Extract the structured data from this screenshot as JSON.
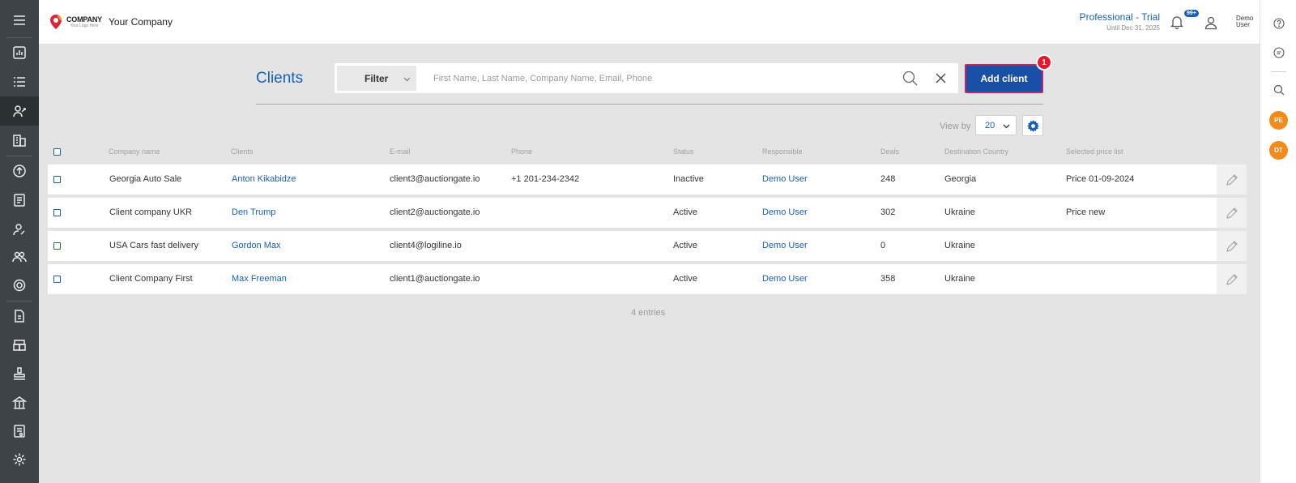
{
  "header": {
    "logo_word": "COMPANY",
    "logo_tagline": "Your Logo Here",
    "company_name": "Your Company",
    "plan_name": "Professional - Trial",
    "plan_until": "Until Dec 31, 2025",
    "notifications_badge": "99+",
    "user_name": "Demo User"
  },
  "sidebar": {
    "items": [
      {
        "icon": "menu-icon"
      },
      {
        "icon": "dashboard-icon"
      },
      {
        "icon": "list-icon"
      },
      {
        "icon": "clients-icon",
        "active": true
      },
      {
        "icon": "buildings-icon"
      },
      {
        "icon": "exchange-icon"
      },
      {
        "icon": "ledger-icon"
      },
      {
        "icon": "user-edit-icon"
      },
      {
        "icon": "team-icon"
      },
      {
        "icon": "settings-gear-icon"
      },
      {
        "icon": "document-icon"
      },
      {
        "icon": "warehouse-icon"
      },
      {
        "icon": "stamp-icon"
      },
      {
        "icon": "port-icon"
      },
      {
        "icon": "invoice-icon"
      },
      {
        "icon": "settings-icon"
      }
    ]
  },
  "rightbar": {
    "avatars": [
      "PE",
      "DT"
    ]
  },
  "toolbar": {
    "title": "Clients",
    "filter_label": "Filter",
    "search_placeholder": "First Name, Last Name, Company Name, Email, Phone",
    "add_client_label": "Add client",
    "hint_badge": "1",
    "view_by_label": "View by",
    "view_by_value": "20"
  },
  "table": {
    "columns": [
      "Company name",
      "Clients",
      "E-mail",
      "Phone",
      "Status",
      "Responsible",
      "Deals",
      "Destination Country",
      "Selected price list"
    ],
    "rows": [
      {
        "company": "Georgia Auto Sale",
        "client": "Anton Kikabidze",
        "email": "client3@auctiongate.io",
        "phone": "+1 201-234-2342",
        "status": "Inactive",
        "responsible": "Demo User",
        "deals": "248",
        "country": "Georgia",
        "price_list": "Price 01-09-2024"
      },
      {
        "company": "Client company UKR",
        "client": "Den Trump",
        "email": "client2@auctiongate.io",
        "phone": "",
        "status": "Active",
        "responsible": "Demo User",
        "deals": "302",
        "country": "Ukraine",
        "price_list": "Price new"
      },
      {
        "company": "USA Cars fast delivery",
        "client": "Gordon Max",
        "email": "client4@logiline.io",
        "phone": "",
        "status": "Active",
        "responsible": "Demo User",
        "deals": "0",
        "country": "Ukraine",
        "price_list": ""
      },
      {
        "company": "Client Company First",
        "client": "Max Freeman",
        "email": "client1@auctiongate.io",
        "phone": "",
        "status": "Active",
        "responsible": "Demo User",
        "deals": "358",
        "country": "Ukraine",
        "price_list": ""
      }
    ],
    "entries_text": "4 entries"
  },
  "colors": {
    "accent": "#1a5fb4",
    "primary_button": "#1a4fa8",
    "sidebar_bg": "#3d4346",
    "avatar": "#f28b1a",
    "badge_red": "#e3182b"
  }
}
